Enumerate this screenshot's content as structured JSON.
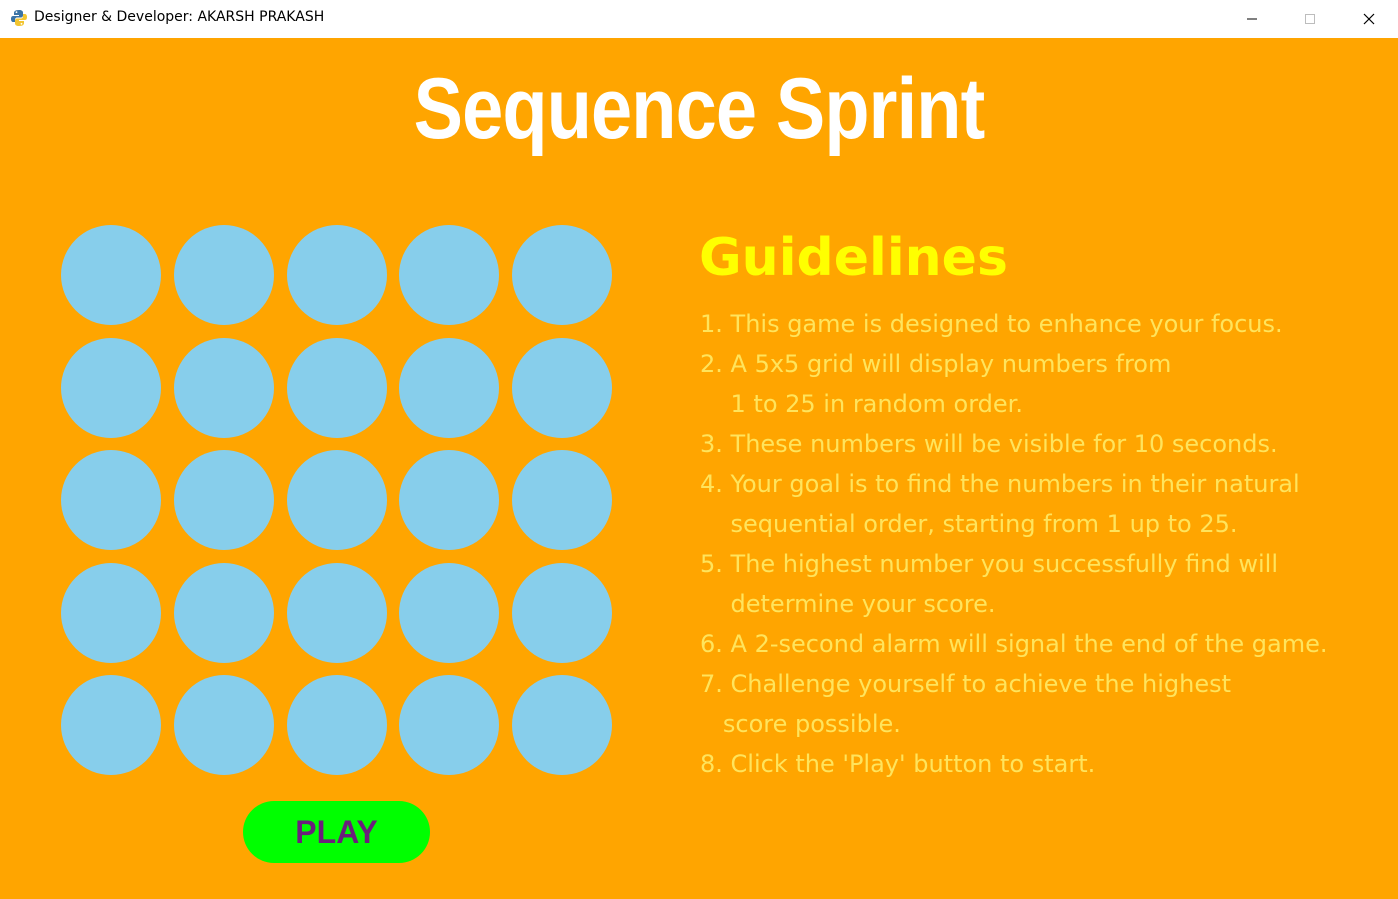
{
  "window": {
    "title": "Designer & Developer: AKARSH PRAKASH",
    "icon": "python-icon",
    "controls": [
      "minimize-icon",
      "maximize-icon",
      "close-icon"
    ]
  },
  "game": {
    "title": "Sequence Sprint",
    "background_color": "#FFA500",
    "circle_color": "#87CEEB",
    "grid_rows": 5,
    "grid_cols": 5,
    "play_button": {
      "label": "PLAY",
      "background_color": "#00FF00",
      "text_color": "#6B1F7B"
    }
  },
  "guidelines": {
    "heading": "Guidelines",
    "heading_color": "#FFFF00",
    "text_color": "#FFE45C",
    "lines": [
      "1. This game is designed to enhance your focus.",
      "2. A 5x5 grid will display numbers from",
      "    1 to 25 in random order.",
      "3. These numbers will be visible for 10 seconds.",
      "4. Your goal is to find the numbers in their natural",
      "    sequential order, starting from 1 up to 25.",
      "5. The highest number you successfully find will",
      "    determine your score.",
      "6. A 2-second alarm will signal the end of the game.",
      "7. Challenge yourself to achieve the highest",
      "   score possible.",
      "8. Click the 'Play' button to start."
    ]
  }
}
